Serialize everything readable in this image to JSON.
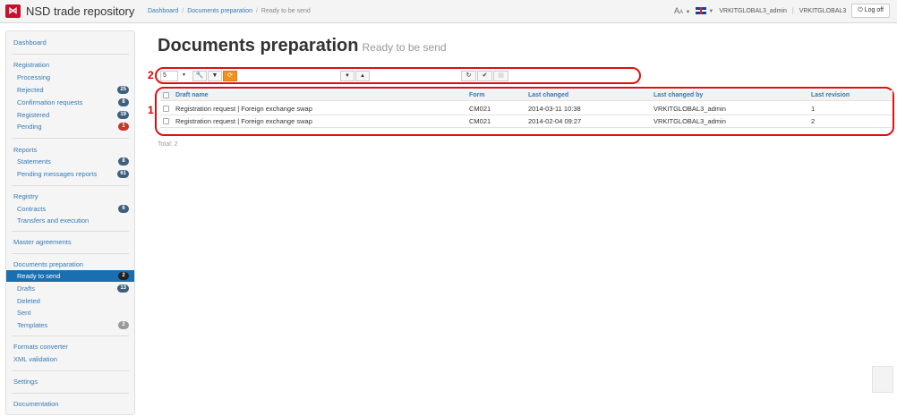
{
  "header": {
    "logo_icon": "nsd-logo-icon",
    "app_title": "NSD trade repository",
    "breadcrumb": [
      "Dashboard",
      "Documents preparation",
      "Ready to be send"
    ],
    "font_size_control": "A",
    "language_flag": "uk-flag-icon",
    "user": "VRKITGLOBAL3_admin",
    "org": "VRKITGLOBAL3",
    "logoff_label": "Log off"
  },
  "sidebar": {
    "dashboard": "Dashboard",
    "registration": {
      "title": "Registration",
      "items": [
        {
          "label": "Processing",
          "badge": ""
        },
        {
          "label": "Rejected",
          "badge": "25"
        },
        {
          "label": "Confirmation requests",
          "badge": "8"
        },
        {
          "label": "Registered",
          "badge": "19"
        },
        {
          "label": "Pending",
          "badge": "1"
        }
      ]
    },
    "reports": {
      "title": "Reports",
      "items": [
        {
          "label": "Statements",
          "badge": "8"
        },
        {
          "label": "Pending messages reports",
          "badge": "61"
        }
      ]
    },
    "registry": {
      "title": "Registry",
      "items": [
        {
          "label": "Contracts",
          "badge": "6"
        },
        {
          "label": "Transfers and execution",
          "badge": ""
        }
      ]
    },
    "master_agreements": "Master agreements",
    "documents_preparation": {
      "title": "Documents preparation",
      "items": [
        {
          "label": "Ready to send",
          "badge": "2"
        },
        {
          "label": "Drafts",
          "badge": "13"
        },
        {
          "label": "Deleted",
          "badge": ""
        },
        {
          "label": "Sent",
          "badge": ""
        },
        {
          "label": "Templates",
          "badge": "2"
        }
      ]
    },
    "formats_converter": "Formats converter",
    "xml_validation": "XML validation",
    "settings": "Settings",
    "documentation": "Documentation"
  },
  "main": {
    "title": "Documents preparation",
    "subtitle": "Ready to be send",
    "annotation_1": "1",
    "annotation_2": "2",
    "toolbar": {
      "page_size": "5",
      "icons": [
        "wrench-icon",
        "filter-icon",
        "refresh-sync-icon",
        "sort-down-icon",
        "sort-up-icon",
        "reload-icon",
        "check-icon",
        "delete-icon"
      ]
    },
    "table": {
      "columns": [
        "Draft name",
        "Form",
        "Last changed",
        "Last changed by",
        "Last revision"
      ],
      "rows": [
        [
          "Registration request | Foreign exchange swap",
          "CM021",
          "2014-03-11 10:38",
          "VRKITGLOBAL3_admin",
          "1"
        ],
        [
          "Registration request | Foreign exchange swap",
          "CM021",
          "2014-02-04 09:27",
          "VRKITGLOBAL3_admin",
          "2"
        ]
      ]
    },
    "total": "Total: 2"
  },
  "colors": {
    "accent": "#1a6fb0",
    "link": "#337ab7",
    "logo": "#c8102e",
    "toolbar_active": "#f0921e",
    "annotation": "#dd1111"
  }
}
